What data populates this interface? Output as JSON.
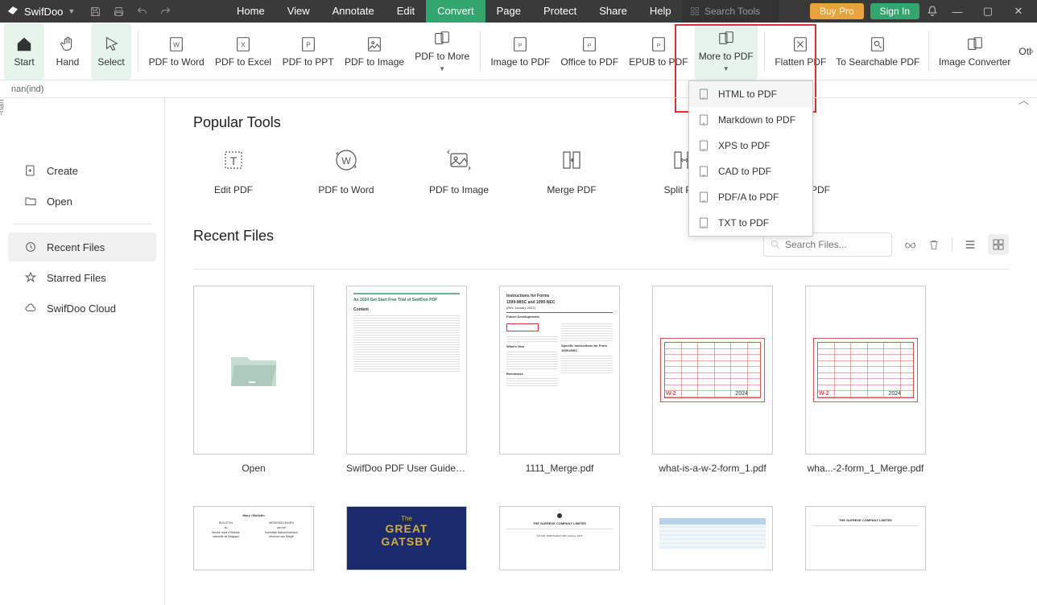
{
  "app": {
    "name": "SwifDoo"
  },
  "titlebar": {
    "buy": "Buy Pro",
    "signin": "Sign In",
    "search_placeholder": "Search Tools"
  },
  "menus": [
    "Home",
    "View",
    "Annotate",
    "Edit",
    "Convert",
    "Page",
    "Protect",
    "Share",
    "Help"
  ],
  "menus_active_index": 4,
  "ribbon": {
    "start": "Start",
    "hand": "Hand",
    "select": "Select",
    "pdf_to_word": "PDF to Word",
    "pdf_to_excel": "PDF to Excel",
    "pdf_to_ppt": "PDF to PPT",
    "pdf_to_image": "PDF to Image",
    "pdf_to_more": "PDF to More",
    "image_to_pdf": "Image to PDF",
    "office_to_pdf": "Office to PDF",
    "epub_to_pdf": "EPUB to PDF",
    "more_to_pdf": "More to PDF",
    "flatten_pdf": "Flatten PDF",
    "to_searchable_pdf": "To Searchable PDF",
    "image_converter": "Image Converter",
    "other": "Otl"
  },
  "dropdown": {
    "items": [
      "HTML to PDF",
      "Markdown to PDF",
      "XPS to PDF",
      "CAD to PDF",
      "PDF/A to PDF",
      "TXT to PDF"
    ],
    "highlighted_index": 0
  },
  "doctab": {
    "label": "nan(ind)",
    "side": "-nan"
  },
  "sidebar": {
    "create": "Create",
    "open": "Open",
    "recent": "Recent Files",
    "starred": "Starred Files",
    "cloud": "SwifDoo Cloud"
  },
  "main": {
    "popular_title": "Popular Tools",
    "recent_title": "Recent Files",
    "search_placeholder": "Search Files..."
  },
  "popular": {
    "edit": "Edit PDF",
    "pdf_to_word": "PDF to Word",
    "pdf_to_image": "PDF to Image",
    "merge": "Merge PDF",
    "split": "Split PDF",
    "compress": "Compress PDF"
  },
  "files": [
    {
      "name": "Open",
      "type": "folder"
    },
    {
      "name": "SwifDoo PDF User Guide.pdf",
      "type": "guide"
    },
    {
      "name": "1111_Merge.pdf",
      "type": "instructions"
    },
    {
      "name": "what-is-a-w-2-form_1.pdf",
      "type": "w2",
      "year": "2024"
    },
    {
      "name": "wha...-2-form_1_Merge.pdf",
      "type": "w2",
      "year": "2024"
    },
    {
      "name": "",
      "type": "bulletin"
    },
    {
      "name": "",
      "type": "gatsby"
    },
    {
      "name": "",
      "type": "company"
    },
    {
      "name": "",
      "type": "table"
    },
    {
      "name": "",
      "type": "company"
    }
  ],
  "gatsby": {
    "the": "The",
    "great": "GREAT",
    "gatsby": "GATSBY"
  }
}
